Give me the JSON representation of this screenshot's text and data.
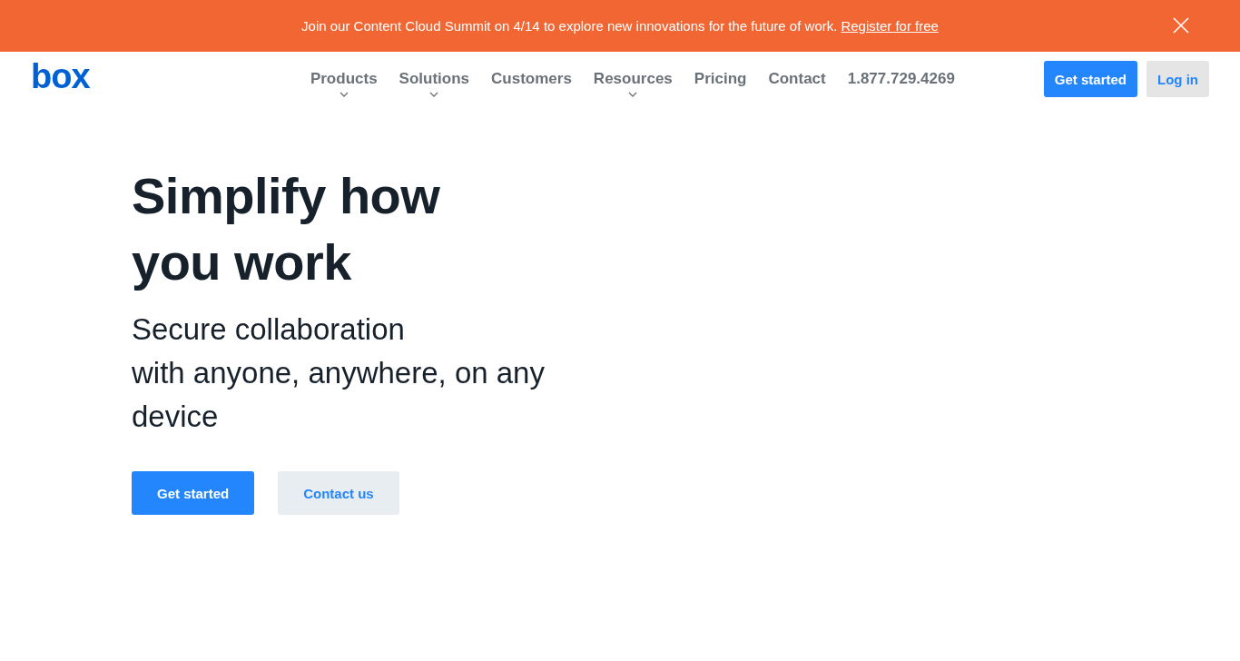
{
  "banner": {
    "text": "Join our Content Cloud Summit on 4/14 to explore new innovations for the future of work.",
    "link": "Register for free"
  },
  "header": {
    "logo": "box",
    "nav": [
      {
        "label": "Products",
        "has_menu": true
      },
      {
        "label": "Solutions",
        "has_menu": true
      },
      {
        "label": "Customers",
        "has_menu": false
      },
      {
        "label": "Resources",
        "has_menu": true
      },
      {
        "label": "Pricing",
        "has_menu": false
      },
      {
        "label": "Contact",
        "has_menu": false
      },
      {
        "label": "1.877.729.4269",
        "has_menu": false
      }
    ],
    "actions": [
      {
        "label": "Get started",
        "kind": "primary"
      },
      {
        "label": "Log in",
        "kind": "secondary"
      }
    ]
  },
  "hero": {
    "title_lines": [
      "Simplify how",
      "you work"
    ],
    "subtitle_lines": [
      "Secure collaboration",
      "with anyone, anywhere, on any",
      "device"
    ],
    "buttons": [
      {
        "label": "Get started",
        "kind": "primary"
      },
      {
        "label": "Contact us",
        "kind": "secondary"
      }
    ]
  }
}
